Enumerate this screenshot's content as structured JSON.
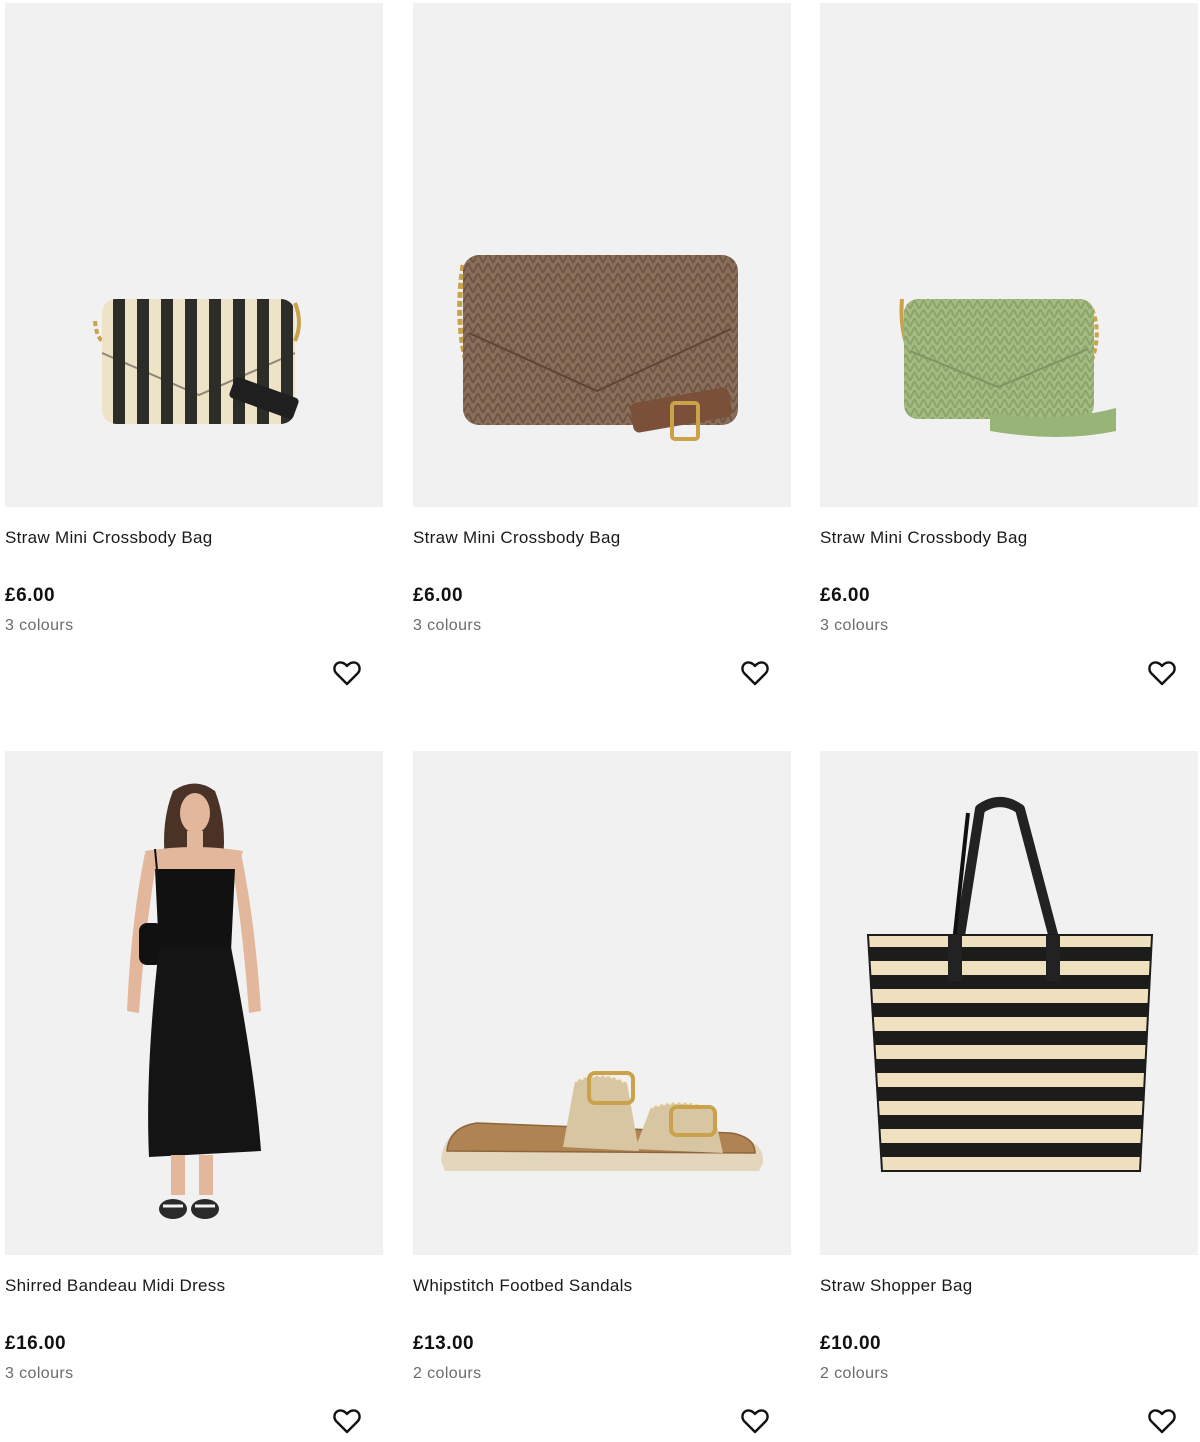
{
  "products": [
    {
      "title": "Straw Mini Crossbody Bag",
      "price": "£6.00",
      "colours": "3 colours",
      "image": "striped-mini-crossbody-bag"
    },
    {
      "title": "Straw Mini Crossbody Bag",
      "price": "£6.00",
      "colours": "3 colours",
      "image": "brown-mini-crossbody-bag"
    },
    {
      "title": "Straw Mini Crossbody Bag",
      "price": "£6.00",
      "colours": "3 colours",
      "image": "green-mini-crossbody-bag"
    },
    {
      "title": "Shirred Bandeau Midi Dress",
      "price": "£16.00",
      "colours": "3 colours",
      "image": "black-midi-dress-model"
    },
    {
      "title": "Whipstitch Footbed Sandals",
      "price": "£13.00",
      "colours": "2 colours",
      "image": "beige-footbed-sandal"
    },
    {
      "title": "Straw Shopper Bag",
      "price": "£10.00",
      "colours": "2 colours",
      "image": "striped-straw-shopper-bag"
    }
  ],
  "icons": {
    "wishlist": "heart-outline-icon"
  },
  "colors": {
    "image_bg": "#f1f1f1",
    "muted_text": "#6b6b6b",
    "text": "#111111"
  }
}
